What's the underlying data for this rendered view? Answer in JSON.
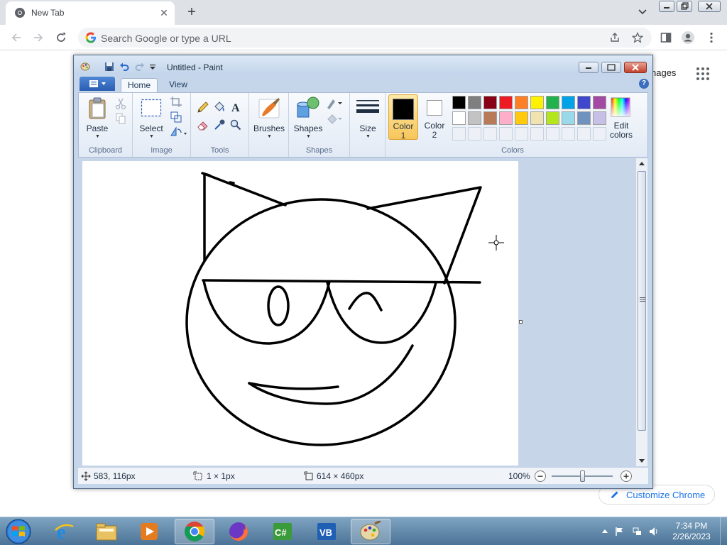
{
  "browser": {
    "tab_title": "New Tab",
    "omnibox_placeholder": "Search Google or type a URL",
    "images_link": "nages",
    "customize_label": "Customize Chrome"
  },
  "paint": {
    "title": "Untitled - Paint",
    "tabs": [
      {
        "label": "Home"
      },
      {
        "label": "View"
      }
    ],
    "groups": {
      "clipboard": "Clipboard",
      "image": "Image",
      "tools": "Tools",
      "shapes": "Shapes",
      "colors": "Colors"
    },
    "buttons": {
      "paste": "Paste",
      "select": "Select",
      "brushes": "Brushes",
      "shapes": "Shapes",
      "size": "Size",
      "color1_line1": "Color",
      "color1_line2": "1",
      "color2_line1": "Color",
      "color2_line2": "2",
      "edit_colors_line1": "Edit",
      "edit_colors_line2": "colors"
    },
    "palette_row1": [
      "#000000",
      "#7f7f7f",
      "#880015",
      "#ed1c24",
      "#ff7f27",
      "#fff200",
      "#22b14c",
      "#00a2e8",
      "#3f48cc",
      "#a349a4"
    ],
    "palette_row2": [
      "#ffffff",
      "#c3c3c3",
      "#b97a57",
      "#ffaec9",
      "#ffc90e",
      "#efe4b0",
      "#b5e61d",
      "#99d9ea",
      "#7092be",
      "#c8bfe7"
    ],
    "color1": "#000000",
    "color2": "#ffffff",
    "status": {
      "cursor_pos": "583, 116px",
      "selection_size": "1 × 1px",
      "image_size": "614 × 460px",
      "zoom": "100%",
      "zoom_level": 1.0
    }
  },
  "taskbar": {
    "time": "7:34 PM",
    "date": "2/26/2023"
  }
}
